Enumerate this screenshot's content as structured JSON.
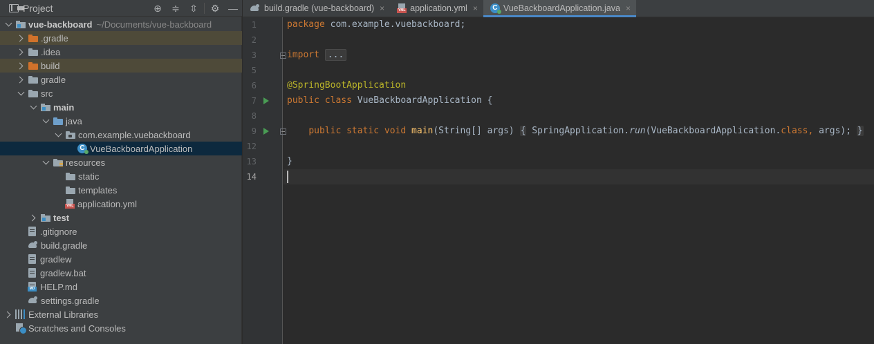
{
  "project_pane": {
    "title": "Project",
    "tools": [
      "locate-icon",
      "expand-all-icon",
      "collapse-all-icon",
      "gear-icon",
      "hide-icon"
    ],
    "tree": [
      {
        "depth": 0,
        "arrow": "down",
        "icon": "module",
        "label": "vue-backboard",
        "bold": true,
        "path": "~/Documents/vue-backboard",
        "state": ""
      },
      {
        "depth": 1,
        "arrow": "right",
        "icon": "folder-orange",
        "label": ".gradle",
        "state": "excluded"
      },
      {
        "depth": 1,
        "arrow": "right",
        "icon": "folder-grey",
        "label": ".idea",
        "state": ""
      },
      {
        "depth": 1,
        "arrow": "right",
        "icon": "folder-orange",
        "label": "build",
        "state": "excluded"
      },
      {
        "depth": 1,
        "arrow": "right",
        "icon": "folder-grey",
        "label": "gradle",
        "state": ""
      },
      {
        "depth": 1,
        "arrow": "down",
        "icon": "folder-grey",
        "label": "src",
        "state": ""
      },
      {
        "depth": 2,
        "arrow": "down",
        "icon": "module",
        "label": "main",
        "bold": true,
        "state": ""
      },
      {
        "depth": 3,
        "arrow": "down",
        "icon": "folder-blue",
        "label": "java",
        "state": ""
      },
      {
        "depth": 4,
        "arrow": "down",
        "icon": "folder-package",
        "label": "com.example.vuebackboard",
        "state": ""
      },
      {
        "depth": 5,
        "arrow": "none",
        "icon": "class",
        "label": "VueBackboardApplication",
        "state": "selected"
      },
      {
        "depth": 3,
        "arrow": "down",
        "icon": "folder-resources",
        "label": "resources",
        "state": ""
      },
      {
        "depth": 4,
        "arrow": "none",
        "icon": "folder-grey",
        "label": "static",
        "state": ""
      },
      {
        "depth": 4,
        "arrow": "none",
        "icon": "folder-grey",
        "label": "templates",
        "state": ""
      },
      {
        "depth": 4,
        "arrow": "none",
        "icon": "yml",
        "label": "application.yml",
        "state": ""
      },
      {
        "depth": 2,
        "arrow": "right",
        "icon": "module",
        "label": "test",
        "bold": true,
        "state": ""
      },
      {
        "depth": 1,
        "arrow": "none",
        "icon": "file",
        "label": ".gitignore",
        "state": ""
      },
      {
        "depth": 1,
        "arrow": "none",
        "icon": "gradle",
        "label": "build.gradle",
        "state": ""
      },
      {
        "depth": 1,
        "arrow": "none",
        "icon": "file",
        "label": "gradlew",
        "state": ""
      },
      {
        "depth": 1,
        "arrow": "none",
        "icon": "file",
        "label": "gradlew.bat",
        "state": ""
      },
      {
        "depth": 1,
        "arrow": "none",
        "icon": "md",
        "label": "HELP.md",
        "state": ""
      },
      {
        "depth": 1,
        "arrow": "none",
        "icon": "gradle",
        "label": "settings.gradle",
        "state": ""
      },
      {
        "depth": 0,
        "arrow": "right",
        "icon": "libraries",
        "label": "External Libraries",
        "state": ""
      },
      {
        "depth": 0,
        "arrow": "none",
        "icon": "scratches",
        "label": "Scratches and Consoles",
        "state": ""
      }
    ]
  },
  "tabs": [
    {
      "label": "build.gradle (vue-backboard)",
      "icon": "gradle",
      "active": false
    },
    {
      "label": "application.yml",
      "icon": "yml",
      "active": false
    },
    {
      "label": "VueBackboardApplication.java",
      "icon": "class",
      "active": true
    }
  ],
  "editor": {
    "line_numbers": [
      "1",
      "2",
      "3",
      "5",
      "6",
      "7",
      "8",
      "9",
      "12",
      "13",
      "14"
    ],
    "current_line": "14",
    "code": {
      "l1_kw": "package",
      "l1_rest": " com.example.vuebackboard;",
      "l3_kw": "import",
      "l3_fold": "...",
      "l6_ann": "@SpringBootApplication",
      "l7_kw1": "public",
      "l7_kw2": "class",
      "l7_rest": " VueBackboardApplication {",
      "l9_kw1": "public",
      "l9_kw2": "static",
      "l9_kw3": "void",
      "l9_fn": "main",
      "l9_sig": "(String[] args)",
      "l9_open": "{",
      "l9_call1": " SpringApplication.",
      "l9_run": "run",
      "l9_call2": "(VueBackboardApplication.",
      "l9_cls": "class",
      "l9_comma": ",",
      "l9_args": " args); ",
      "l9_close": "}",
      "l13": "}"
    }
  }
}
